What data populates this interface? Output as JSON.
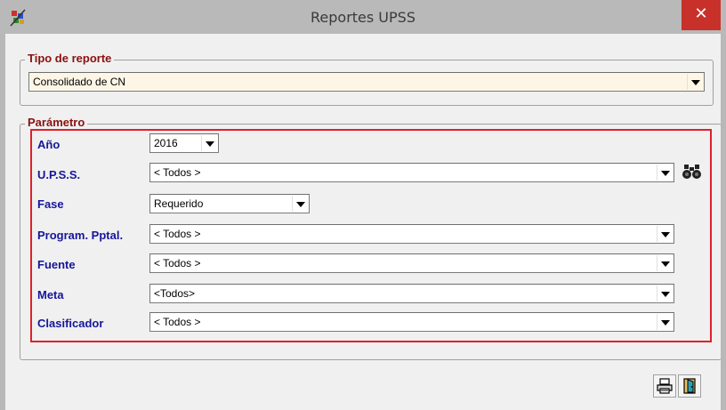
{
  "window": {
    "title": "Reportes UPSS",
    "close_glyph": "✕"
  },
  "tipo_reporte": {
    "legend": "Tipo de reporte",
    "value": "Consolidado de CN"
  },
  "parametro": {
    "legend": "Parámetro",
    "fields": [
      {
        "label": "Año",
        "value": "2016"
      },
      {
        "label": "U.P.S.S.",
        "value": "< Todos >"
      },
      {
        "label": "Fase",
        "value": "Requerido"
      },
      {
        "label": "Program. Pptal.",
        "value": "< Todos >"
      },
      {
        "label": "Fuente",
        "value": "< Todos >"
      },
      {
        "label": "Meta",
        "value": "<Todos>"
      },
      {
        "label": "Clasificador",
        "value": "< Todos >"
      }
    ]
  },
  "icons": {
    "app": "app-logo-icon",
    "search": "binoculars-icon",
    "print": "printer-icon",
    "exit": "exit-door-icon"
  },
  "colors": {
    "legend_text": "#8b1010",
    "label_text": "#16169a",
    "highlight_border": "#e0202a",
    "close_button": "#c8302a",
    "report_combo_bg": "#fdf6e6"
  }
}
